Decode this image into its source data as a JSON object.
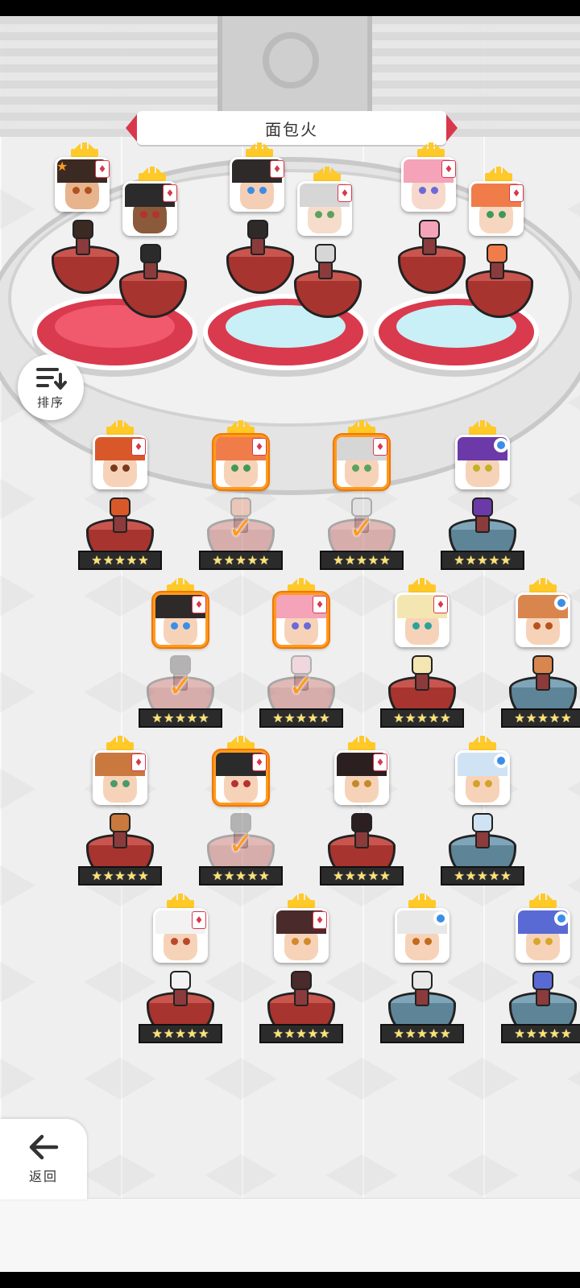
{
  "header": {
    "title": "面包火"
  },
  "controls": {
    "sort_label": "排序",
    "back_label": "返回"
  },
  "stars_text": "★★★★★",
  "check_glyph": "✓",
  "colors": {
    "accent": "#d9384c",
    "selected": "#ff9a1f",
    "crown": "#ffc928"
  },
  "icons": [
    "sort-icon",
    "back-arrow-icon",
    "crown-icon",
    "diamond-tag-icon",
    "circle-tag-icon",
    "checkmark-icon"
  ],
  "team_slots": [
    {
      "hair": "#3b2a22",
      "skin": "#e8b48e",
      "eye": "#b0521e",
      "tag": "diamond",
      "leader": true
    },
    {
      "hair": "#2b2b2b",
      "skin": "#8a5a3b",
      "eye": "#b73131",
      "tag": "diamond",
      "leader": false
    },
    {
      "hair": "#2f2a2a",
      "skin": "#f4cfb5",
      "eye": "#3a8ee8",
      "tag": "diamond",
      "leader": false
    },
    {
      "hair": "#d6d6d6",
      "skin": "#f6dccb",
      "eye": "#5aa35e",
      "tag": "diamond",
      "leader": false
    },
    {
      "hair": "#f4a3b8",
      "skin": "#f7d8cc",
      "eye": "#6a6ad9",
      "tag": "diamond",
      "leader": false
    },
    {
      "hair": "#f07c4a",
      "skin": "#f7d6c0",
      "eye": "#3f9a57",
      "tag": "diamond",
      "leader": false
    }
  ],
  "roster": [
    {
      "hair": "#d9582a",
      "eye": "#7a3a1a",
      "tag": "diamond",
      "selected": false,
      "done": false,
      "ped": "red"
    },
    {
      "hair": "#f07c4a",
      "eye": "#3f9a57",
      "tag": "diamond",
      "selected": true,
      "done": true,
      "ped": "red"
    },
    {
      "hair": "#d6d6d6",
      "eye": "#5aa35e",
      "tag": "diamond",
      "selected": true,
      "done": true,
      "ped": "red"
    },
    {
      "hair": "#6b3aa8",
      "eye": "#c6b02a",
      "tag": "circle",
      "selected": false,
      "done": false,
      "ped": "blue"
    },
    {
      "hair": "#2f2a2a",
      "eye": "#3a8ee8",
      "tag": "diamond",
      "selected": true,
      "done": true,
      "ped": "red"
    },
    {
      "hair": "#f4a3b8",
      "eye": "#6a6ad9",
      "tag": "diamond",
      "selected": true,
      "done": true,
      "ped": "red"
    },
    {
      "hair": "#f4e6b0",
      "eye": "#2aa39a",
      "tag": "diamond",
      "selected": false,
      "done": false,
      "ped": "red"
    },
    {
      "hair": "#d9864e",
      "eye": "#b8521e",
      "tag": "circle",
      "selected": false,
      "done": false,
      "ped": "blue"
    },
    {
      "hair": "#c9783e",
      "eye": "#4a9a6a",
      "tag": "diamond",
      "selected": false,
      "done": false,
      "ped": "red"
    },
    {
      "hair": "#2b2b2b",
      "eye": "#b73131",
      "tag": "diamond",
      "selected": true,
      "done": true,
      "ped": "red"
    },
    {
      "hair": "#2b1f1f",
      "eye": "#c4892a",
      "tag": "diamond",
      "selected": false,
      "done": false,
      "ped": "red"
    },
    {
      "hair": "#cfe3f4",
      "eye": "#d4a12a",
      "tag": "circle",
      "selected": false,
      "done": false,
      "ped": "blue"
    },
    {
      "hair": "#f2f2f2",
      "eye": "#b74a2a",
      "tag": "diamond",
      "selected": false,
      "done": false,
      "ped": "red"
    },
    {
      "hair": "#4a2a2a",
      "eye": "#d48a2a",
      "tag": "diamond",
      "selected": false,
      "done": false,
      "ped": "red"
    },
    {
      "hair": "#e8e8e8",
      "eye": "#c46a1e",
      "tag": "circle",
      "selected": false,
      "done": false,
      "ped": "blue"
    },
    {
      "hair": "#5a6ad4",
      "eye": "#d9a62a",
      "tag": "circle",
      "selected": false,
      "done": false,
      "ped": "blue"
    }
  ]
}
